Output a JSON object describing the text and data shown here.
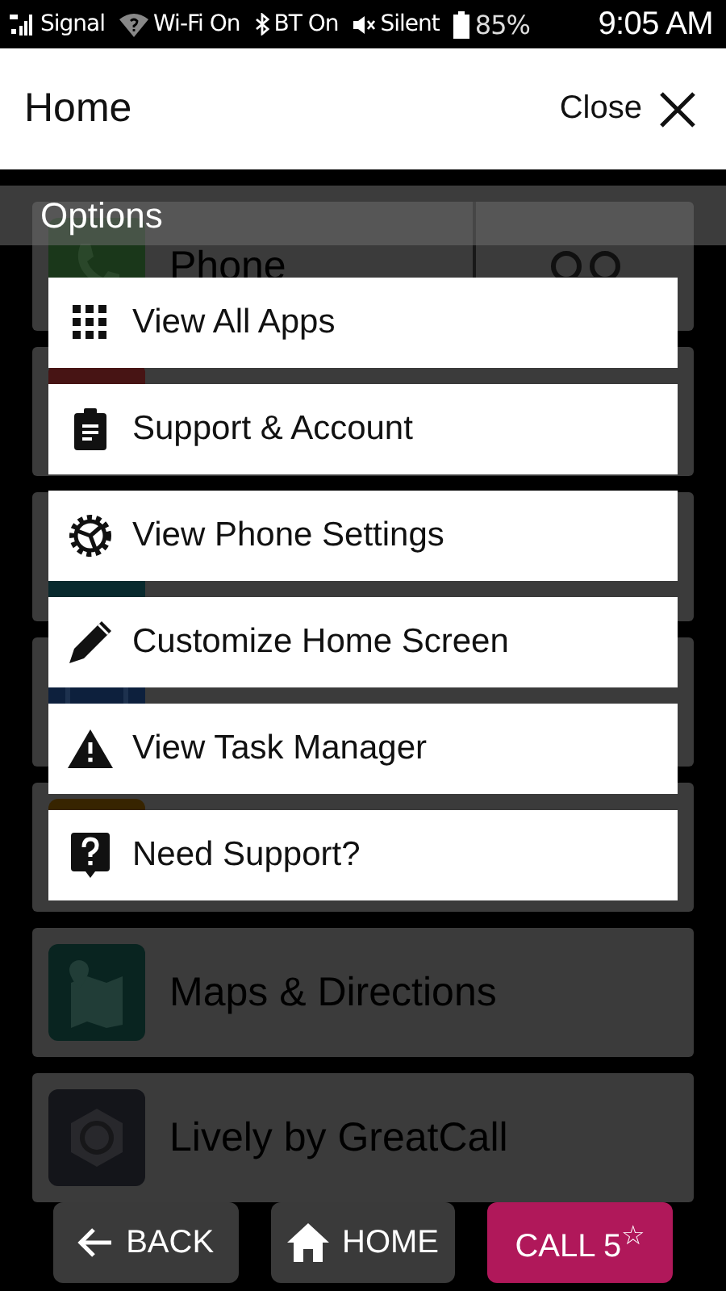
{
  "status_bar": {
    "items": [
      {
        "kind": "signal",
        "label": "Signal"
      },
      {
        "kind": "wifi",
        "label": "Wi-Fi On"
      },
      {
        "kind": "bluetooth",
        "label": "BT On"
      },
      {
        "kind": "silent",
        "label": "Silent"
      },
      {
        "kind": "battery",
        "label": "85%"
      }
    ],
    "time": "9:05 AM"
  },
  "header": {
    "title": "Home",
    "close": "Close"
  },
  "tiles": [
    {
      "kind": "phone",
      "label": "Phone",
      "color": "#1c3a1c"
    },
    {
      "kind": "covered",
      "color": "#4a1515"
    },
    {
      "kind": "covered",
      "color": "#0a2c30"
    },
    {
      "kind": "internet",
      "color": "#0e2240"
    },
    {
      "kind": "covered",
      "color": "#3a2600"
    },
    {
      "kind": "maps",
      "label": "Maps & Directions",
      "color": "#0a2622"
    },
    {
      "kind": "lively",
      "label": "Lively by GreatCall",
      "color": "#15161c"
    }
  ],
  "options": {
    "title": "Options",
    "items": [
      {
        "kind": "grid",
        "label": "View All Apps"
      },
      {
        "kind": "clipboard",
        "label": "Support & Account"
      },
      {
        "kind": "gear",
        "label": "View Phone Settings"
      },
      {
        "kind": "pencil",
        "label": "Customize Home Screen"
      },
      {
        "kind": "warning",
        "label": "View Task Manager"
      },
      {
        "kind": "question",
        "label": "Need Support?"
      }
    ]
  },
  "bottom_bar": [
    {
      "kind": "back",
      "label": "BACK"
    },
    {
      "kind": "home",
      "label": "HOME"
    },
    {
      "kind": "call",
      "label": "CALL 5$^{☆}$"
    }
  ]
}
